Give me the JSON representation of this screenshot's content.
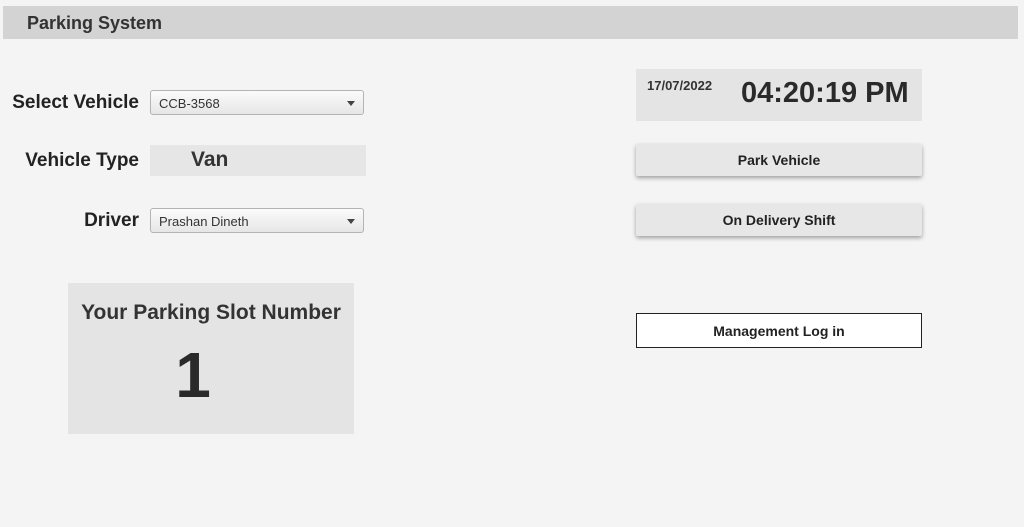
{
  "app": {
    "title": "Parking System"
  },
  "form": {
    "vehicle": {
      "label": "Select Vehicle",
      "selected": "CCB-3568"
    },
    "vehicle_type": {
      "label": "Vehicle Type",
      "value": "Van"
    },
    "driver": {
      "label": "Driver",
      "selected": "Prashan Dineth"
    }
  },
  "slot": {
    "title": "Your Parking Slot Number",
    "number": "1"
  },
  "clock": {
    "date": "17/07/2022",
    "time": "04:20:19 PM"
  },
  "actions": {
    "park_label": "Park Vehicle",
    "delivery_label": "On Delivery Shift",
    "management_label": "Management Log in"
  },
  "colors": {
    "background": "#f4f4f4",
    "title_bar": "#d3d3d3",
    "panel": "#e4e4e4",
    "button": "#e7e7e7"
  },
  "icons": {
    "dropdown": "chevron-down-icon"
  }
}
